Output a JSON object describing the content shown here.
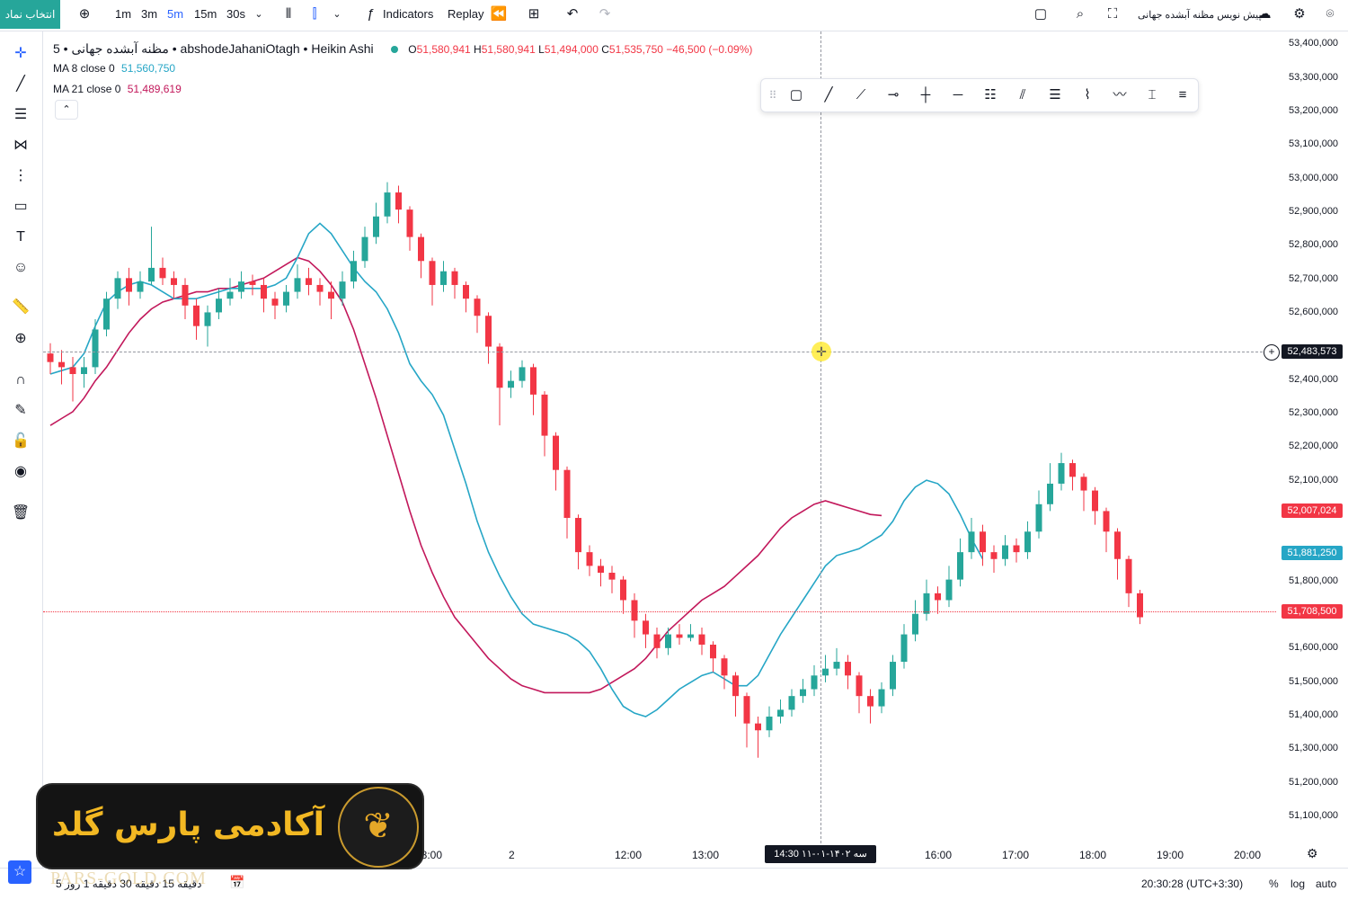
{
  "toolbar": {
    "symbol_button": "انتخاب نماد",
    "intervals": [
      "1m",
      "3m",
      "5m",
      "15m",
      "30s"
    ],
    "active_interval": "5m",
    "indicators_label": "Indicators",
    "replay_label": "Replay",
    "publish_label": "پیش نویس مظنه آبشده جهانی"
  },
  "legend": {
    "title": "مظنه آبشده جهانی • 5 • abshodeJahaniOtagh • Heikin Ashi",
    "ohlc": {
      "O": "51,580,941",
      "H": "51,580,941",
      "L": "51,494,000",
      "C": "51,535,750",
      "change": "−46,500 (−0.09%)"
    },
    "ma8_label": "MA 8 close 0",
    "ma8_value": "51,560,750",
    "ma21_label": "MA 21 close 0",
    "ma21_value": "51,489,619"
  },
  "price_axis": {
    "labels": [
      "53,400,000",
      "53,300,000",
      "53,200,000",
      "53,100,000",
      "53,000,000",
      "52,900,000",
      "52,800,000",
      "52,700,000",
      "52,600,000",
      "52,400,000",
      "52,300,000",
      "52,200,000",
      "52,100,000",
      "51,800,000",
      "51,600,000",
      "51,500,000",
      "51,400,000",
      "51,300,000",
      "51,200,000",
      "51,100,000"
    ],
    "crosshair_price": "52,483,573",
    "ma21_tag": "52,007,024",
    "ma8_tag": "51,881,250",
    "last_price_tag": "51,708,500"
  },
  "time_axis": {
    "labels": [
      "18:00",
      "2",
      "12:00",
      "13:00",
      "16:00",
      "17:00",
      "18:00",
      "19:00",
      "20:00"
    ],
    "crosshair_time": "سه ۱۴۰۲-۰۱-۱۱ 14:30"
  },
  "bottombar": {
    "ranges": "5 دقیقه 15 دقیقه 30 دقیقه 1 روز",
    "clock": "20:30:28 (UTC+3:30)",
    "percent": "%",
    "log": "log",
    "auto": "auto"
  },
  "logo": {
    "text": "آکادمی پارس گلد",
    "watermark": "PARS-GOLD.COM"
  },
  "colors": {
    "up": "#26a69a",
    "down": "#f23645",
    "ma8": "#26a6c6",
    "ma21": "#c2185b",
    "accent": "#2962ff"
  },
  "chart_data": {
    "type": "candlestick",
    "chart_style": "Heikin Ashi",
    "interval": "5m",
    "ylim": [
      51050000,
      53420000
    ],
    "candles": [
      [
        52480000,
        52455000,
        52510000,
        52420000
      ],
      [
        52455000,
        52440000,
        52490000,
        52390000
      ],
      [
        52440000,
        52420000,
        52470000,
        52340000
      ],
      [
        52420000,
        52440000,
        52470000,
        52380000
      ],
      [
        52440000,
        52550000,
        52580000,
        52420000
      ],
      [
        52550000,
        52640000,
        52660000,
        52530000
      ],
      [
        52640000,
        52700000,
        52720000,
        52610000
      ],
      [
        52700000,
        52660000,
        52730000,
        52620000
      ],
      [
        52660000,
        52690000,
        52720000,
        52640000
      ],
      [
        52690000,
        52730000,
        52850000,
        52680000
      ],
      [
        52730000,
        52700000,
        52760000,
        52680000
      ],
      [
        52700000,
        52680000,
        52720000,
        52640000
      ],
      [
        52680000,
        52620000,
        52700000,
        52580000
      ],
      [
        52620000,
        52560000,
        52640000,
        52520000
      ],
      [
        52560000,
        52600000,
        52620000,
        52500000
      ],
      [
        52600000,
        52640000,
        52670000,
        52580000
      ],
      [
        52640000,
        52660000,
        52700000,
        52620000
      ],
      [
        52660000,
        52690000,
        52720000,
        52640000
      ],
      [
        52690000,
        52680000,
        52710000,
        52650000
      ],
      [
        52680000,
        52640000,
        52700000,
        52600000
      ],
      [
        52640000,
        52620000,
        52660000,
        52580000
      ],
      [
        52620000,
        52660000,
        52680000,
        52600000
      ],
      [
        52660000,
        52700000,
        52740000,
        52640000
      ],
      [
        52700000,
        52680000,
        52730000,
        52650000
      ],
      [
        52680000,
        52660000,
        52700000,
        52620000
      ],
      [
        52660000,
        52640000,
        52690000,
        52580000
      ],
      [
        52640000,
        52690000,
        52720000,
        52620000
      ],
      [
        52690000,
        52750000,
        52780000,
        52670000
      ],
      [
        52750000,
        52820000,
        52850000,
        52730000
      ],
      [
        52820000,
        52880000,
        52920000,
        52800000
      ],
      [
        52880000,
        52950000,
        52980000,
        52860000
      ],
      [
        52950000,
        52900000,
        52970000,
        52860000
      ],
      [
        52900000,
        52820000,
        52910000,
        52780000
      ],
      [
        52820000,
        52750000,
        52830000,
        52700000
      ],
      [
        52750000,
        52680000,
        52760000,
        52620000
      ],
      [
        52680000,
        52720000,
        52750000,
        52660000
      ],
      [
        52720000,
        52680000,
        52730000,
        52640000
      ],
      [
        52680000,
        52640000,
        52690000,
        52600000
      ],
      [
        52640000,
        52590000,
        52650000,
        52540000
      ],
      [
        52590000,
        52500000,
        52600000,
        52450000
      ],
      [
        52500000,
        52380000,
        52510000,
        52270000
      ],
      [
        52380000,
        52400000,
        52430000,
        52350000
      ],
      [
        52400000,
        52440000,
        52460000,
        52380000
      ],
      [
        52440000,
        52360000,
        52450000,
        52300000
      ],
      [
        52360000,
        52240000,
        52370000,
        52180000
      ],
      [
        52240000,
        52140000,
        52250000,
        52080000
      ],
      [
        52140000,
        52000000,
        52150000,
        51940000
      ],
      [
        52000000,
        51900000,
        52010000,
        51850000
      ],
      [
        51900000,
        51860000,
        51920000,
        51830000
      ],
      [
        51860000,
        51840000,
        51880000,
        51800000
      ],
      [
        51840000,
        51820000,
        51860000,
        51780000
      ],
      [
        51820000,
        51760000,
        51830000,
        51720000
      ],
      [
        51760000,
        51700000,
        51780000,
        51650000
      ],
      [
        51700000,
        51660000,
        51720000,
        51620000
      ],
      [
        51660000,
        51620000,
        51680000,
        51590000
      ],
      [
        51620000,
        51660000,
        51680000,
        51600000
      ],
      [
        51660000,
        51650000,
        51690000,
        51630000
      ],
      [
        51650000,
        51660000,
        51690000,
        51640000
      ],
      [
        51660000,
        51630000,
        51680000,
        51600000
      ],
      [
        51630000,
        51590000,
        51640000,
        51550000
      ],
      [
        51590000,
        51540000,
        51600000,
        51500000
      ],
      [
        51540000,
        51480000,
        51550000,
        51420000
      ],
      [
        51480000,
        51400000,
        51490000,
        51330000
      ],
      [
        51400000,
        51380000,
        51420000,
        51300000
      ],
      [
        51380000,
        51420000,
        51450000,
        51360000
      ],
      [
        51420000,
        51440000,
        51470000,
        51400000
      ],
      [
        51440000,
        51480000,
        51500000,
        51420000
      ],
      [
        51480000,
        51500000,
        51530000,
        51460000
      ],
      [
        51500000,
        51540000,
        51570000,
        51480000
      ],
      [
        51540000,
        51560000,
        51600000,
        51520000
      ],
      [
        51560000,
        51580000,
        51620000,
        51540000
      ],
      [
        51580000,
        51540000,
        51600000,
        51500000
      ],
      [
        51540000,
        51480000,
        51550000,
        51430000
      ],
      [
        51480000,
        51450000,
        51500000,
        51400000
      ],
      [
        51450000,
        51500000,
        51520000,
        51430000
      ],
      [
        51500000,
        51580000,
        51600000,
        51480000
      ],
      [
        51580000,
        51660000,
        51690000,
        51560000
      ],
      [
        51660000,
        51720000,
        51760000,
        51640000
      ],
      [
        51720000,
        51780000,
        51820000,
        51700000
      ],
      [
        51780000,
        51760000,
        51800000,
        51720000
      ],
      [
        51760000,
        51820000,
        51860000,
        51740000
      ],
      [
        51820000,
        51900000,
        51940000,
        51800000
      ],
      [
        51900000,
        51960000,
        52000000,
        51880000
      ],
      [
        51960000,
        51900000,
        51980000,
        51860000
      ],
      [
        51900000,
        51880000,
        51920000,
        51840000
      ],
      [
        51880000,
        51920000,
        51950000,
        51860000
      ],
      [
        51920000,
        51900000,
        51940000,
        51870000
      ],
      [
        51900000,
        51960000,
        51990000,
        51880000
      ],
      [
        51960000,
        52040000,
        52080000,
        51940000
      ],
      [
        52040000,
        52100000,
        52160000,
        52020000
      ],
      [
        52100000,
        52160000,
        52190000,
        52080000
      ],
      [
        52160000,
        52120000,
        52170000,
        52080000
      ],
      [
        52120000,
        52080000,
        52130000,
        52020000
      ],
      [
        52080000,
        52020000,
        52090000,
        51980000
      ],
      [
        52020000,
        51960000,
        52030000,
        51900000
      ],
      [
        51960000,
        51880000,
        51970000,
        51820000
      ],
      [
        51880000,
        51780000,
        51890000,
        51740000
      ],
      [
        51780000,
        51710000,
        51790000,
        51690000
      ]
    ],
    "ma8": [
      52420000,
      52430000,
      52440000,
      52480000,
      52560000,
      52630000,
      52660000,
      52680000,
      52690000,
      52680000,
      52660000,
      52640000,
      52640000,
      52640000,
      52650000,
      52660000,
      52670000,
      52670000,
      52670000,
      52670000,
      52680000,
      52700000,
      52760000,
      52830000,
      52860000,
      52830000,
      52780000,
      52730000,
      52690000,
      52660000,
      52610000,
      52540000,
      52450000,
      52400000,
      52360000,
      52300000,
      52200000,
      52100000,
      51990000,
      51900000,
      51830000,
      51770000,
      51720000,
      51690000,
      51680000,
      51670000,
      51660000,
      51640000,
      51610000,
      51560000,
      51500000,
      51450000,
      51430000,
      51420000,
      51440000,
      51470000,
      51500000,
      51520000,
      51540000,
      51550000,
      51530000,
      51510000,
      51510000,
      51540000,
      51600000,
      51660000,
      51710000,
      51760000,
      51810000,
      51860000,
      51890000,
      51900000,
      51910000,
      51930000,
      51950000,
      51990000,
      52050000,
      52090000,
      52110000,
      52100000,
      52070000,
      52010000,
      51940000,
      51880000
    ],
    "ma21": [
      52270000,
      52290000,
      52310000,
      52350000,
      52400000,
      52440000,
      52490000,
      52540000,
      52580000,
      52610000,
      52630000,
      52640000,
      52650000,
      52660000,
      52660000,
      52670000,
      52670000,
      52680000,
      52690000,
      52700000,
      52720000,
      52740000,
      52760000,
      52750000,
      52720000,
      52680000,
      52630000,
      52550000,
      52450000,
      52350000,
      52240000,
      52130000,
      52020000,
      51920000,
      51840000,
      51770000,
      51710000,
      51670000,
      51630000,
      51590000,
      51560000,
      51530000,
      51510000,
      51500000,
      51490000,
      51490000,
      51490000,
      51490000,
      51490000,
      51500000,
      51520000,
      51540000,
      51560000,
      51590000,
      51630000,
      51670000,
      51700000,
      51730000,
      51760000,
      51780000,
      51800000,
      51830000,
      51860000,
      51890000,
      51930000,
      51970000,
      52000000,
      52020000,
      52040000,
      52050000,
      52040000,
      52030000,
      52020000,
      52010000,
      52007024
    ]
  }
}
